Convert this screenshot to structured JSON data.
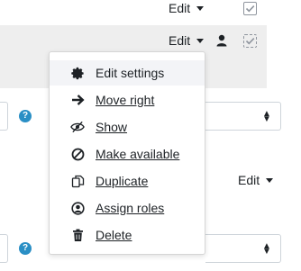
{
  "row1": {
    "edit_label": "Edit"
  },
  "row2": {
    "edit_label": "Edit"
  },
  "row3": {
    "edit_label": "Edit"
  },
  "help_icon_glyph": "?",
  "menu": {
    "items": [
      {
        "label": "Edit settings",
        "icon": "gear-icon"
      },
      {
        "label": " Move right",
        "icon": "arrow-right-icon"
      },
      {
        "label": " Show",
        "icon": "eye-slash-icon"
      },
      {
        "label": " Make available",
        "icon": "ban-icon"
      },
      {
        "label": " Duplicate",
        "icon": "copy-icon"
      },
      {
        "label": " Assign roles",
        "icon": "user-icon"
      },
      {
        "label": " Delete",
        "icon": "trash-icon"
      }
    ]
  },
  "colors": {
    "highlight": "#eeeeee",
    "help_blue": "#2a8fc5",
    "menu_active": "#f3f4f7"
  }
}
